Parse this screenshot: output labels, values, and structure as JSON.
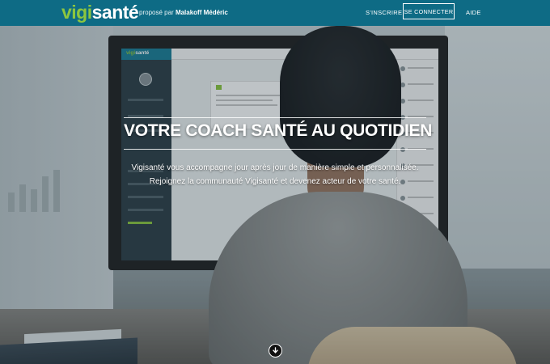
{
  "header": {
    "logo": {
      "part_a": "vigi",
      "part_b": "santé"
    },
    "tagline_prefix": "proposé par",
    "tagline_brand": "Malakoff Médéric",
    "nav": {
      "signup": "S'INSCRIRE",
      "login": "SE CONNECTER",
      "help": "AIDE"
    }
  },
  "hero": {
    "headline": "VOTRE COACH SANTÉ AU QUOTIDIEN",
    "subline_1": "Vigisanté vous accompagne jour après jour de manière simple et personnalisée.",
    "subline_2": "Rejoignez la communauté Vigisanté et devenez acteur de votre santé.",
    "scroll_icon": "arrow-down-circle-icon"
  },
  "colors": {
    "header_bg": "#0e6b85",
    "logo_green": "#8cc63f",
    "text_light": "#ffffff"
  }
}
